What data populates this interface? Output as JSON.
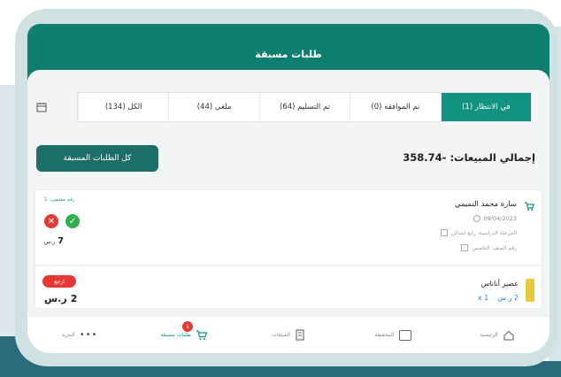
{
  "header": {
    "title": "طلبات مسبقة"
  },
  "tabs": [
    {
      "label": "في الانتظار (1)",
      "active": true
    },
    {
      "label": "تم الموافقة (0)",
      "active": false
    },
    {
      "label": "تم التسليم (64)",
      "active": false
    },
    {
      "label": "ملغى (44)",
      "active": false
    },
    {
      "label": "الكل (134)",
      "active": false
    }
  ],
  "summary": {
    "total_label": "إجمالي المبيعات:",
    "total_value": "-358.74"
  },
  "actions": {
    "all_orders_label": "كل الطلبات المسبقة"
  },
  "orders": [
    {
      "name": "سارة محمد التميمي",
      "date": "09/04/2023",
      "stage": "المرحلة الدراسية: رابع ابتدائي",
      "grade": "رقم الصف: الخامس",
      "ref": "رقم مقتضى: 1",
      "price": "7",
      "currency": "ر.س"
    },
    {
      "name": "عصير أناناس",
      "badge": "ارجع",
      "unit_price": "2 ر.س",
      "qty": "1 x",
      "price": "2",
      "currency": "ر.س"
    }
  ],
  "nav": [
    {
      "label": "الرئيسية",
      "icon": "home-icon",
      "active": false
    },
    {
      "label": "المحفظة",
      "icon": "wallet-icon",
      "active": false
    },
    {
      "label": "المبيعات",
      "icon": "receipt-icon",
      "active": false
    },
    {
      "label": "طلبات مسبقة",
      "icon": "cart-icon",
      "active": true,
      "badge": "1"
    },
    {
      "label": "المزيد",
      "icon": "more-icon",
      "active": false
    }
  ],
  "colors": {
    "primary": "#0e7e6f",
    "accent": "#12937f",
    "danger": "#e53935",
    "success": "#2db04f"
  }
}
